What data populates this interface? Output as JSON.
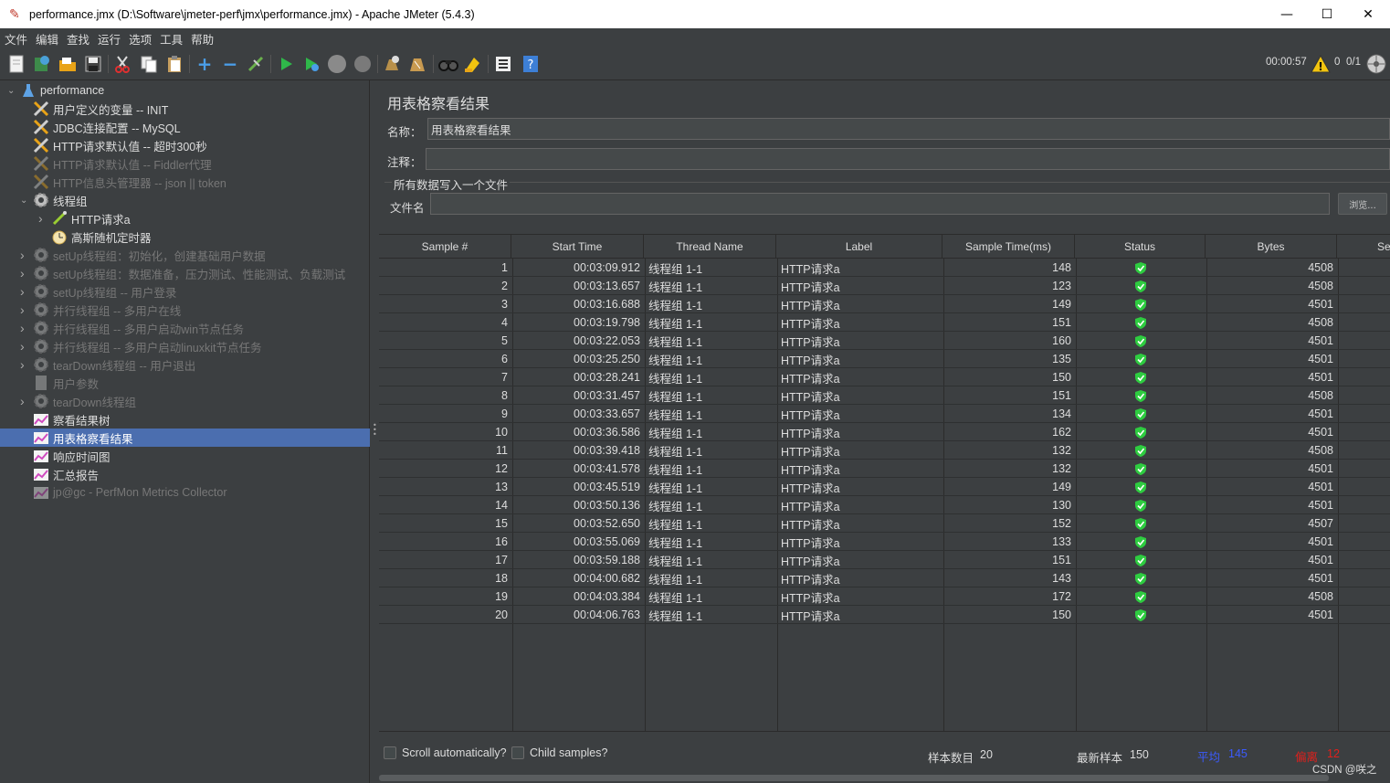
{
  "window": {
    "title": "performance.jmx (D:\\Software\\jmeter-perf\\jmx\\performance.jmx) - Apache JMeter (5.4.3)",
    "minimize": "—",
    "maximize": "☐",
    "close": "✕"
  },
  "menu": [
    "文件",
    "编辑",
    "查找",
    "运行",
    "选项",
    "工具",
    "帮助"
  ],
  "toolbar": {
    "elapsed": "00:00:57",
    "warnings": "0",
    "threads": "0/1"
  },
  "tree": {
    "root": "performance",
    "nodes": [
      {
        "label": "用户定义的变量 -- INIT",
        "icon": "wrench-icon",
        "disabled": false
      },
      {
        "label": "JDBC连接配置 -- MySQL",
        "icon": "wrench-icon",
        "disabled": false
      },
      {
        "label": "HTTP请求默认值 -- 超时300秒",
        "icon": "wrench-icon",
        "disabled": false
      },
      {
        "label": "HTTP请求默认值 -- Fiddler代理",
        "icon": "wrench-icon",
        "disabled": true
      },
      {
        "label": "HTTP信息头管理器 -- json || token",
        "icon": "wrench-icon",
        "disabled": true
      },
      {
        "label": "线程组",
        "icon": "gear-icon",
        "disabled": false
      },
      {
        "label": "HTTP请求a",
        "icon": "pipette-icon",
        "disabled": false
      },
      {
        "label": "高斯随机定时器",
        "icon": "timer-icon",
        "disabled": false
      },
      {
        "label": "setUp线程组：初始化，创建基础用户数据",
        "icon": "gear-icon",
        "disabled": true
      },
      {
        "label": "setUp线程组：数据准备，压力测试、性能测试、负载测试",
        "icon": "gear-icon",
        "disabled": true
      },
      {
        "label": "setUp线程组 -- 用户登录",
        "icon": "gear-icon",
        "disabled": true
      },
      {
        "label": "并行线程组 -- 多用户在线",
        "icon": "gear-icon",
        "disabled": true
      },
      {
        "label": "并行线程组 -- 多用户启动win节点任务",
        "icon": "gear-icon",
        "disabled": true
      },
      {
        "label": "并行线程组 -- 多用户启动linuxkit节点任务",
        "icon": "gear-icon",
        "disabled": true
      },
      {
        "label": "tearDown线程组 -- 用户退出",
        "icon": "gear-icon",
        "disabled": true
      },
      {
        "label": "用户参数",
        "icon": "params-icon",
        "disabled": true
      },
      {
        "label": "tearDown线程组",
        "icon": "gear-icon",
        "disabled": true
      },
      {
        "label": "察看结果树",
        "icon": "chart-icon",
        "disabled": false
      },
      {
        "label": "用表格察看结果",
        "icon": "chart-icon",
        "disabled": false
      },
      {
        "label": "响应时间图",
        "icon": "chart-icon",
        "disabled": false
      },
      {
        "label": "汇总报告",
        "icon": "chart-icon",
        "disabled": false
      },
      {
        "label": "jp@gc - PerfMon Metrics Collector",
        "icon": "chart-icon",
        "disabled": true
      }
    ]
  },
  "panel": {
    "title": "用表格察看结果",
    "name_label": "名称：",
    "name_value": "用表格察看结果",
    "comment_label": "注释：",
    "comment_value": "",
    "group_title": "所有数据写入一个文件",
    "file_label": "文件名",
    "file_value": "",
    "browse_label": "浏览..."
  },
  "table": {
    "columns": [
      "Sample #",
      "Start Time",
      "Thread Name",
      "Label",
      "Sample Time(ms)",
      "Status",
      "Bytes",
      "Se"
    ],
    "rows": [
      [
        "1",
        "00:03:09.912",
        "线程组 1-1",
        "HTTP请求a",
        "148",
        "4508"
      ],
      [
        "2",
        "00:03:13.657",
        "线程组 1-1",
        "HTTP请求a",
        "123",
        "4508"
      ],
      [
        "3",
        "00:03:16.688",
        "线程组 1-1",
        "HTTP请求a",
        "149",
        "4501"
      ],
      [
        "4",
        "00:03:19.798",
        "线程组 1-1",
        "HTTP请求a",
        "151",
        "4508"
      ],
      [
        "5",
        "00:03:22.053",
        "线程组 1-1",
        "HTTP请求a",
        "160",
        "4501"
      ],
      [
        "6",
        "00:03:25.250",
        "线程组 1-1",
        "HTTP请求a",
        "135",
        "4501"
      ],
      [
        "7",
        "00:03:28.241",
        "线程组 1-1",
        "HTTP请求a",
        "150",
        "4501"
      ],
      [
        "8",
        "00:03:31.457",
        "线程组 1-1",
        "HTTP请求a",
        "151",
        "4508"
      ],
      [
        "9",
        "00:03:33.657",
        "线程组 1-1",
        "HTTP请求a",
        "134",
        "4501"
      ],
      [
        "10",
        "00:03:36.586",
        "线程组 1-1",
        "HTTP请求a",
        "162",
        "4501"
      ],
      [
        "11",
        "00:03:39.418",
        "线程组 1-1",
        "HTTP请求a",
        "132",
        "4508"
      ],
      [
        "12",
        "00:03:41.578",
        "线程组 1-1",
        "HTTP请求a",
        "132",
        "4501"
      ],
      [
        "13",
        "00:03:45.519",
        "线程组 1-1",
        "HTTP请求a",
        "149",
        "4501"
      ],
      [
        "14",
        "00:03:50.136",
        "线程组 1-1",
        "HTTP请求a",
        "130",
        "4501"
      ],
      [
        "15",
        "00:03:52.650",
        "线程组 1-1",
        "HTTP请求a",
        "152",
        "4507"
      ],
      [
        "16",
        "00:03:55.069",
        "线程组 1-1",
        "HTTP请求a",
        "133",
        "4501"
      ],
      [
        "17",
        "00:03:59.188",
        "线程组 1-1",
        "HTTP请求a",
        "151",
        "4501"
      ],
      [
        "18",
        "00:04:00.682",
        "线程组 1-1",
        "HTTP请求a",
        "143",
        "4501"
      ],
      [
        "19",
        "00:04:03.384",
        "线程组 1-1",
        "HTTP请求a",
        "172",
        "4508"
      ],
      [
        "20",
        "00:04:06.763",
        "线程组 1-1",
        "HTTP请求a",
        "150",
        "4501"
      ]
    ]
  },
  "footer": {
    "scroll_label": "Scroll automatically?",
    "child_label": "Child samples?",
    "count_label": "样本数目",
    "count_value": "20",
    "latest_label": "最新样本",
    "latest_value": "150",
    "avg_label": "平均",
    "avg_value": "145",
    "dev_label": "偏离",
    "dev_value": "12"
  },
  "watermark": "CSDN @咲之",
  "colors": {
    "background": "#3c3f41",
    "selected": "#4b6eaf",
    "success": "#2ecc40",
    "avg": "#3b5bff",
    "dev": "#e0201c"
  }
}
